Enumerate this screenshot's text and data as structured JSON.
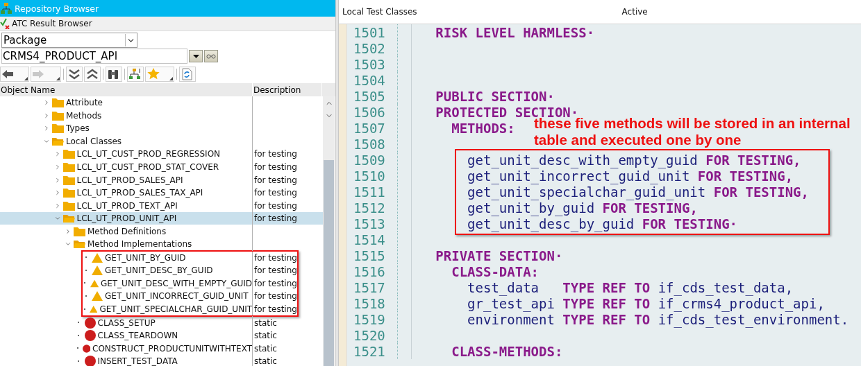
{
  "title_bar": {
    "title": "Repository Browser"
  },
  "secondary_bar": {
    "title": "ATC Result Browser"
  },
  "object_type": {
    "value": "Package"
  },
  "object_name": {
    "value": "CRMS4_PRODUCT_API"
  },
  "tree_columns": [
    "Object Name",
    "Description"
  ],
  "tree": [
    {
      "label": "Attribute",
      "kind": "folder",
      "expanded": false,
      "selected": false
    },
    {
      "label": "Methods",
      "kind": "folder",
      "expanded": false,
      "selected": false
    },
    {
      "label": "Types",
      "kind": "folder",
      "expanded": false,
      "selected": false
    },
    {
      "label": "Local Classes",
      "kind": "folder",
      "expanded": true,
      "selected": false,
      "children": [
        {
          "label": "LCL_UT_CUST_PROD_REGRESSION",
          "description": "for testing",
          "kind": "folder",
          "expanded": false,
          "selected": false
        },
        {
          "label": "LCL_UT_CUST_PROD_STAT_COVER",
          "description": "for testing",
          "kind": "folder",
          "expanded": false,
          "selected": false
        },
        {
          "label": "LCL_UT_PROD_SALES_API",
          "description": "for testing",
          "kind": "folder",
          "expanded": false,
          "selected": false
        },
        {
          "label": "LCL_UT_PROD_SALES_TAX_API",
          "description": "for testing",
          "kind": "folder",
          "expanded": false,
          "selected": false
        },
        {
          "label": "LCL_UT_PROD_TEXT_API",
          "description": "for testing",
          "kind": "folder",
          "expanded": false,
          "selected": false
        },
        {
          "label": "LCL_UT_PROD_UNIT_API",
          "description": "for testing",
          "kind": "folder",
          "expanded": true,
          "selected": true,
          "children": [
            {
              "label": "Method Definitions",
              "kind": "folder",
              "expanded": false,
              "selected": false
            },
            {
              "label": "Method Implementations",
              "kind": "folder",
              "expanded": true,
              "selected": false,
              "children": [
                {
                  "label": "GET_UNIT_BY_GUID",
                  "description": "for testing",
                  "kind": "warning",
                  "boxed": true,
                  "selected": false
                },
                {
                  "label": "GET_UNIT_DESC_BY_GUID",
                  "description": "for testing",
                  "kind": "warning",
                  "boxed": true,
                  "selected": false
                },
                {
                  "label": "GET_UNIT_DESC_WITH_EMPTY_GUID",
                  "description": "for testing",
                  "kind": "warning",
                  "boxed": true,
                  "selected": false
                },
                {
                  "label": "GET_UNIT_INCORRECT_GUID_UNIT",
                  "description": "for testing",
                  "kind": "warning",
                  "boxed": true,
                  "selected": false
                },
                {
                  "label": "GET_UNIT_SPECIALCHAR_GUID_UNIT",
                  "description": "for testing",
                  "kind": "warning",
                  "boxed": true,
                  "selected": false
                },
                {
                  "label": "CLASS_SETUP",
                  "description": "static",
                  "kind": "error",
                  "boxed": false,
                  "selected": false
                },
                {
                  "label": "CLASS_TEARDOWN",
                  "description": "static",
                  "kind": "error",
                  "boxed": false,
                  "selected": false
                },
                {
                  "label": "CONSTRUCT_PRODUCTUNITWITHTEXT",
                  "description": "static",
                  "kind": "error",
                  "boxed": false,
                  "selected": false
                },
                {
                  "label": "INSERT_TEST_DATA",
                  "description": "static",
                  "kind": "error",
                  "boxed": false,
                  "selected": false
                }
              ]
            }
          ]
        }
      ]
    }
  ],
  "editor": {
    "tab": "Local Test Classes",
    "status": "Active",
    "annotation": "these five methods will be stored in an internal table and executed one by one",
    "lines": [
      {
        "number": "1501",
        "segments": [
          {
            "kind": "keyword",
            "text": "   RISK LEVEL HARMLESS·"
          }
        ]
      },
      {
        "number": "1502"
      },
      {
        "number": "1503"
      },
      {
        "number": "1504"
      },
      {
        "number": "1505",
        "segments": [
          {
            "kind": "keyword",
            "text": "   PUBLIC SECTION·"
          }
        ]
      },
      {
        "number": "1506",
        "segments": [
          {
            "kind": "keyword",
            "text": "   PROTECTED SECTION·"
          }
        ]
      },
      {
        "number": "1507",
        "segments": [
          {
            "kind": "keyword",
            "text": "     METHODS:"
          }
        ]
      },
      {
        "number": "1508"
      }
    ],
    "highlighted_lines": [
      {
        "number": "1509",
        "segments": [
          {
            "kind": "ident",
            "text": "       get_unit_desc_with_empty_guid"
          },
          {
            "kind": "keyword",
            "text": " FOR TESTING,"
          }
        ]
      },
      {
        "number": "1510",
        "segments": [
          {
            "kind": "ident",
            "text": "       get_unit_incorrect_guid_unit"
          },
          {
            "kind": "keyword",
            "text": " FOR TESTING,"
          }
        ]
      },
      {
        "number": "1511",
        "segments": [
          {
            "kind": "ident",
            "text": "       get_unit_specialchar_guid_unit"
          },
          {
            "kind": "keyword",
            "text": " FOR TESTING,"
          }
        ]
      },
      {
        "number": "1512",
        "segments": [
          {
            "kind": "ident",
            "text": "       get_unit_by_guid"
          },
          {
            "kind": "keyword",
            "text": " FOR TESTING,"
          }
        ]
      },
      {
        "number": "1513",
        "segments": [
          {
            "kind": "ident",
            "text": "       get_unit_desc_by_guid"
          },
          {
            "kind": "keyword",
            "text": " FOR TESTING·"
          }
        ]
      }
    ],
    "lines_after": [
      {
        "number": "1514"
      },
      {
        "number": "1515",
        "segments": [
          {
            "kind": "keyword",
            "text": "   PRIVATE SECTION·"
          }
        ]
      },
      {
        "number": "1516",
        "segments": [
          {
            "kind": "keyword",
            "text": "     CLASS-DATA:"
          }
        ]
      },
      {
        "number": "1517",
        "segments": [
          {
            "kind": "ident",
            "text": "       test_data"
          },
          {
            "kind": "keyword",
            "text": "   TYPE REF TO"
          },
          {
            "kind": "ident",
            "text": " if_cds_test_data,"
          }
        ]
      },
      {
        "number": "1518",
        "segments": [
          {
            "kind": "ident",
            "text": "       gr_test_api"
          },
          {
            "kind": "keyword",
            "text": " TYPE REF TO"
          },
          {
            "kind": "ident",
            "text": " if_crms4_product_api,"
          }
        ]
      },
      {
        "number": "1519",
        "segments": [
          {
            "kind": "ident",
            "text": "       environment"
          },
          {
            "kind": "keyword",
            "text": " TYPE REF TO"
          },
          {
            "kind": "ident",
            "text": " if_cds_test_environment."
          }
        ]
      },
      {
        "number": "1520"
      },
      {
        "number": "1521",
        "segments": [
          {
            "kind": "keyword",
            "text": "     CLASS-METHODS:"
          }
        ]
      }
    ]
  }
}
